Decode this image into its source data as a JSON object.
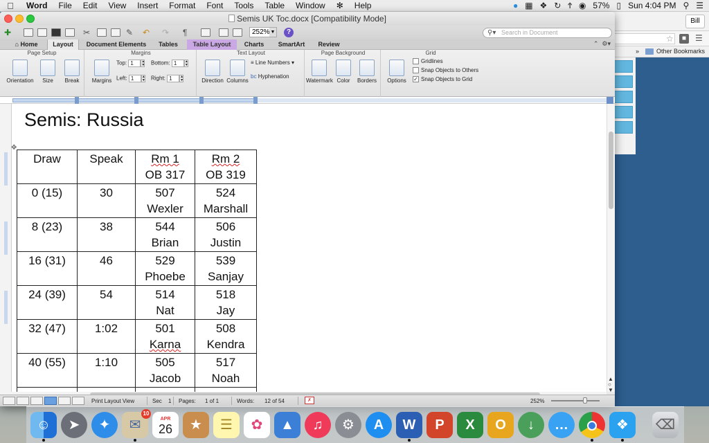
{
  "menubar": {
    "app_name": "Word",
    "items": [
      "File",
      "Edit",
      "View",
      "Insert",
      "Format",
      "Font",
      "Tools",
      "Table",
      "Window",
      "Help"
    ],
    "battery": "57%",
    "clock": "Sun 4:04 PM"
  },
  "window": {
    "title": "Semis UK Toc.docx [Compatibility Mode]",
    "zoom": "252%",
    "search_placeholder": "Search in Document"
  },
  "ribbon_tabs": [
    "Home",
    "Layout",
    "Document Elements",
    "Tables",
    "Table Layout",
    "Charts",
    "SmartArt",
    "Review"
  ],
  "ribbon": {
    "page_setup": {
      "title": "Page Setup",
      "orientation": "Orientation",
      "size": "Size",
      "break": "Break"
    },
    "margins": {
      "title": "Margins",
      "margins_btn": "Margins",
      "top_label": "Top:",
      "top_value": "1",
      "bottom_label": "Bottom:",
      "bottom_value": "1",
      "left_label": "Left:",
      "left_value": "1",
      "right_label": "Right:",
      "right_value": "1"
    },
    "text_layout": {
      "title": "Text Layout",
      "direction": "Direction",
      "columns": "Columns",
      "line_numbers": "Line Numbers",
      "hyphenation": "Hyphenation"
    },
    "page_background": {
      "title": "Page Background",
      "watermark": "Watermark",
      "color": "Color",
      "borders": "Borders"
    },
    "grid": {
      "title": "Grid",
      "options": "Options",
      "gridlines": "Gridlines",
      "snap_objects": "Snap Objects to Others",
      "snap_grid": "Snap Objects to Grid"
    }
  },
  "document": {
    "heading": "Semis: Russia",
    "table": {
      "header": [
        {
          "line1": "Draw",
          "line2": ""
        },
        {
          "line1": "Speak",
          "line2": ""
        },
        {
          "line1": "Rm 1",
          "line2": "OB 317"
        },
        {
          "line1": "Rm 2",
          "line2": "OB 319"
        }
      ],
      "rows": [
        {
          "draw": "0 (15)",
          "speak": "30",
          "rm1_num": "507",
          "rm1_name": "Wexler",
          "rm2_num": "524",
          "rm2_name": "Marshall"
        },
        {
          "draw": "8 (23)",
          "speak": "38",
          "rm1_num": "544",
          "rm1_name": "Brian",
          "rm2_num": "506",
          "rm2_name": "Justin"
        },
        {
          "draw": "16 (31)",
          "speak": "46",
          "rm1_num": "529",
          "rm1_name": "Phoebe",
          "rm2_num": "539",
          "rm2_name": "Sanjay"
        },
        {
          "draw": "24 (39)",
          "speak": "54",
          "rm1_num": "514",
          "rm1_name": "Nat",
          "rm2_num": "518",
          "rm2_name": "Jay"
        },
        {
          "draw": "32 (47)",
          "speak": "1:02",
          "rm1_num": "501",
          "rm1_name": "Karna",
          "rm2_num": "508",
          "rm2_name": "Kendra"
        },
        {
          "draw": "40 (55)",
          "speak": "1:10",
          "rm1_num": "505",
          "rm1_name": "Jacob",
          "rm2_num": "517",
          "rm2_name": "Noah"
        }
      ]
    }
  },
  "statusbar": {
    "view": "Print Layout View",
    "sec_label": "Sec",
    "sec_value": "1",
    "pages_label": "Pages:",
    "pages_value": "1 of 1",
    "words_label": "Words:",
    "words_value": "12 of 54",
    "zoom": "252%"
  },
  "browser": {
    "user": "Bill",
    "bookmark_folder": "Other Bookmarks"
  },
  "dock": {
    "calendar_month": "APR",
    "calendar_day": "26",
    "mail_badge": "10"
  }
}
